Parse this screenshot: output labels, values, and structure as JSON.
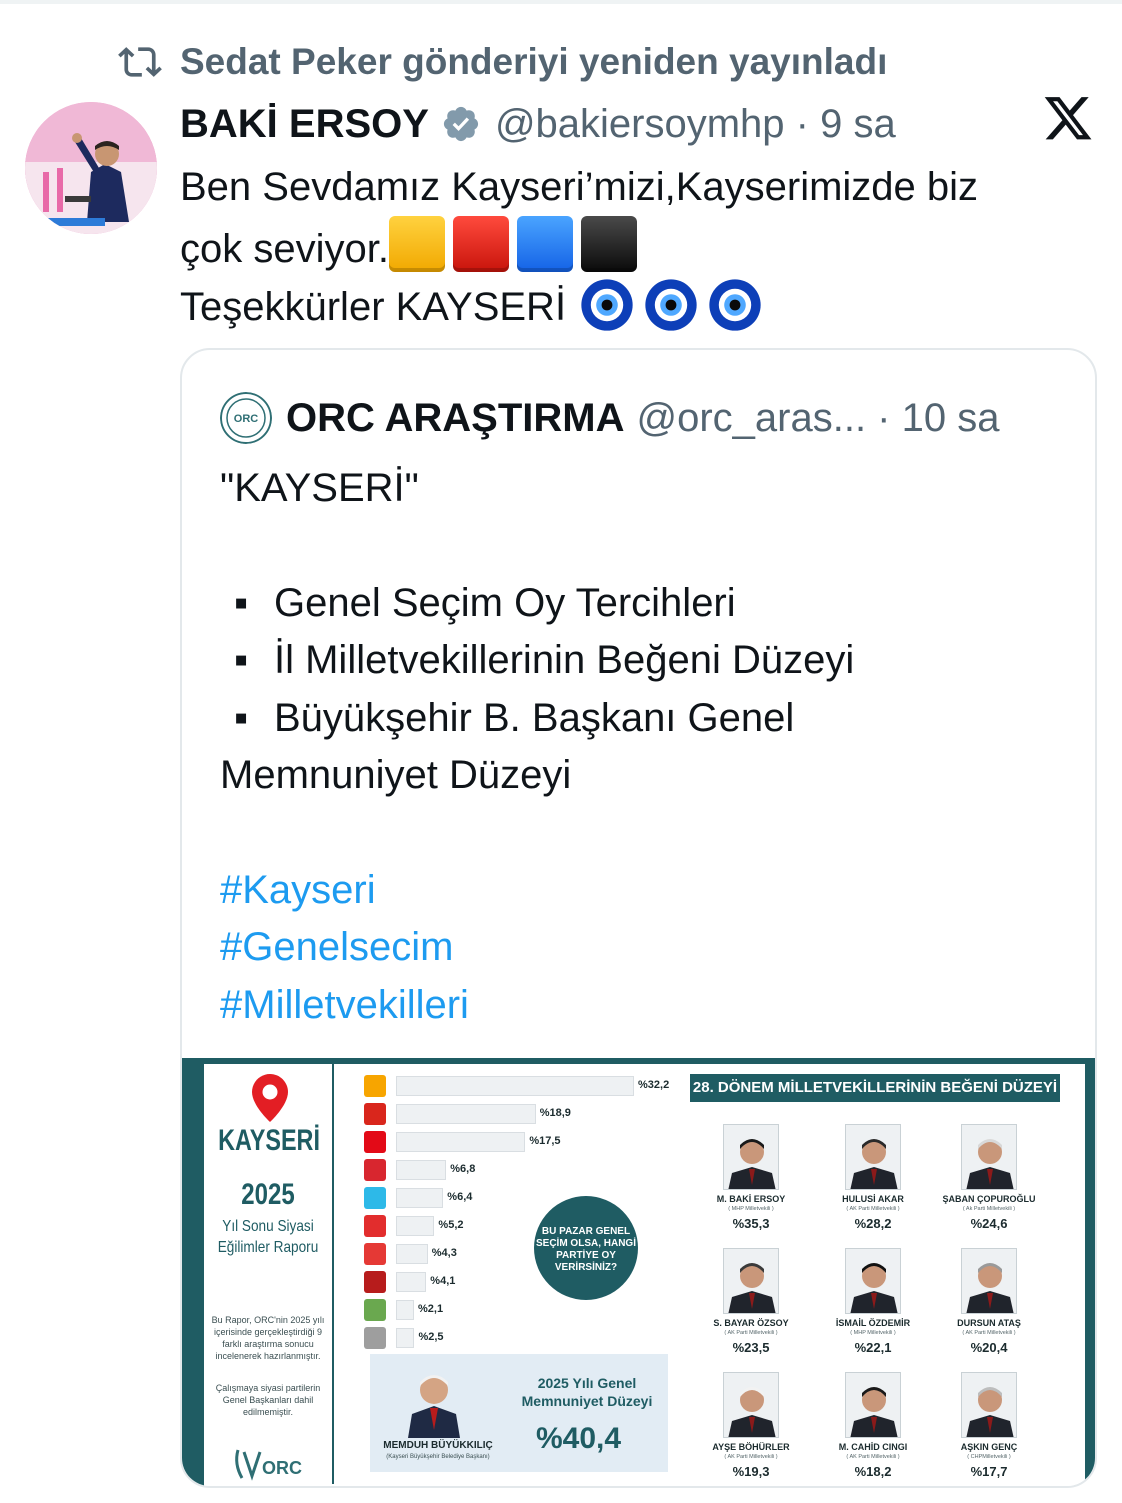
{
  "repost": {
    "label": "Sedat Peker gönderiyi yeniden yayınladı",
    "icon": "repost-icon"
  },
  "post": {
    "author_name": "BAKİ ERSOY",
    "author_handle_time": "@bakiersoymhp · 9 sa",
    "verified_icon": "verified-badge-icon",
    "platform_logo": "x-logo",
    "text_line1": "Ben Sevdamız Kayseri’mizi,Kayserimizde biz",
    "text_line2": "çok seviyor.",
    "text_line3": "Teşekkürler KAYSERİ",
    "emoji_squares": [
      "#f5b800",
      "#e0211a",
      "#2a7cf6",
      "#111111"
    ],
    "emoji_eyes_count": 3
  },
  "quote": {
    "author_name": "ORC ARAŞTIRMA",
    "author_handle_time": "@orc_aras... · 10 sa",
    "title": "\"KAYSERİ\"",
    "bullets": [
      "Genel Seçim Oy Tercihleri",
      "İl Milletvekillerinin Beğeni Düzeyi",
      "Büyükşehir B. Başkanı Genel"
    ],
    "bullet_continuation": "Memnuniyet Düzeyi",
    "hashtags": [
      "#Kayseri",
      "#Genelsecim",
      "#Milletvekilleri"
    ]
  },
  "report": {
    "city": "KAYSERİ",
    "year": "2025",
    "subtitle": "Yıl Sonu Siyasi Eğilimler Raporu",
    "note1": "Bu Rapor, ORC'nin 2025 yılı içerisinde gerçekleştirdiği 9 farklı araştırma sonucu incelenerek hazırlanmıştır.",
    "note2": "Çalışmaya siyasi partilerin Genel Başkanları dahil edilmemiştir.",
    "question": "BU PAZAR GENEL SEÇİM OLSA, HANGİ PARTİYE OY VERİRSİNİZ?",
    "party_bars": [
      {
        "value": 32.2,
        "label": "%32,2",
        "color": "#f7a500"
      },
      {
        "value": 18.9,
        "label": "%18,9",
        "color": "#d9261c"
      },
      {
        "value": 17.5,
        "label": "%17,5",
        "color": "#e30a17"
      },
      {
        "value": 6.8,
        "label": "%6,8",
        "color": "#d8262f"
      },
      {
        "value": 6.4,
        "label": "%6,4",
        "color": "#2db9e8"
      },
      {
        "value": 5.2,
        "label": "%5,2",
        "color": "#e22d2d"
      },
      {
        "value": 4.3,
        "label": "%4,3",
        "color": "#e53935"
      },
      {
        "value": 4.1,
        "label": "%4,1",
        "color": "#b71c1c"
      },
      {
        "value": 2.1,
        "label": "%2,1",
        "color": "#6aa84f"
      },
      {
        "value": 2.5,
        "label": "%2,5",
        "color": "#9e9e9e"
      }
    ],
    "mayor": {
      "name": "MEMDUH BÜYÜKKILIÇ",
      "role": "(Kayseri Büyükşehir Belediye Başkanı)",
      "title": "2025 Yılı Genel Memnuniyet Düzeyi",
      "value": "%40,4"
    },
    "mp_header": "28. DÖNEM MİLLETVEKİLLERİNİN BEĞENİ DÜZEYİ",
    "mps": [
      {
        "name": "M. BAKİ ERSOY",
        "role": "( MHP Milletvekili )",
        "value": "%35,3"
      },
      {
        "name": "HULUSİ AKAR",
        "role": "( AK Parti Milletvekili )",
        "value": "%28,2"
      },
      {
        "name": "ŞABAN ÇOPUROĞLU",
        "role": "( Ak Parti Milletvekili )",
        "value": "%24,6"
      },
      {
        "name": "S. BAYAR ÖZSOY",
        "role": "( AK Parti Milletvekili )",
        "value": "%23,5"
      },
      {
        "name": "İSMAİL ÖZDEMİR",
        "role": "( MHP Milletvekili )",
        "value": "%22,1"
      },
      {
        "name": "DURSUN ATAŞ",
        "role": "( AK Parti Milletvekili )",
        "value": "%20,4"
      },
      {
        "name": "AYŞE BÖHÜRLER",
        "role": "( AK Parti Milletvekili )",
        "value": "%19,3"
      },
      {
        "name": "M. CAHİD CINGI",
        "role": "( AK Parti Milletvekili )",
        "value": "%18,2"
      },
      {
        "name": "AŞKIN GENÇ",
        "role": "( CHPMilletvekili )",
        "value": "%17,7"
      }
    ]
  }
}
